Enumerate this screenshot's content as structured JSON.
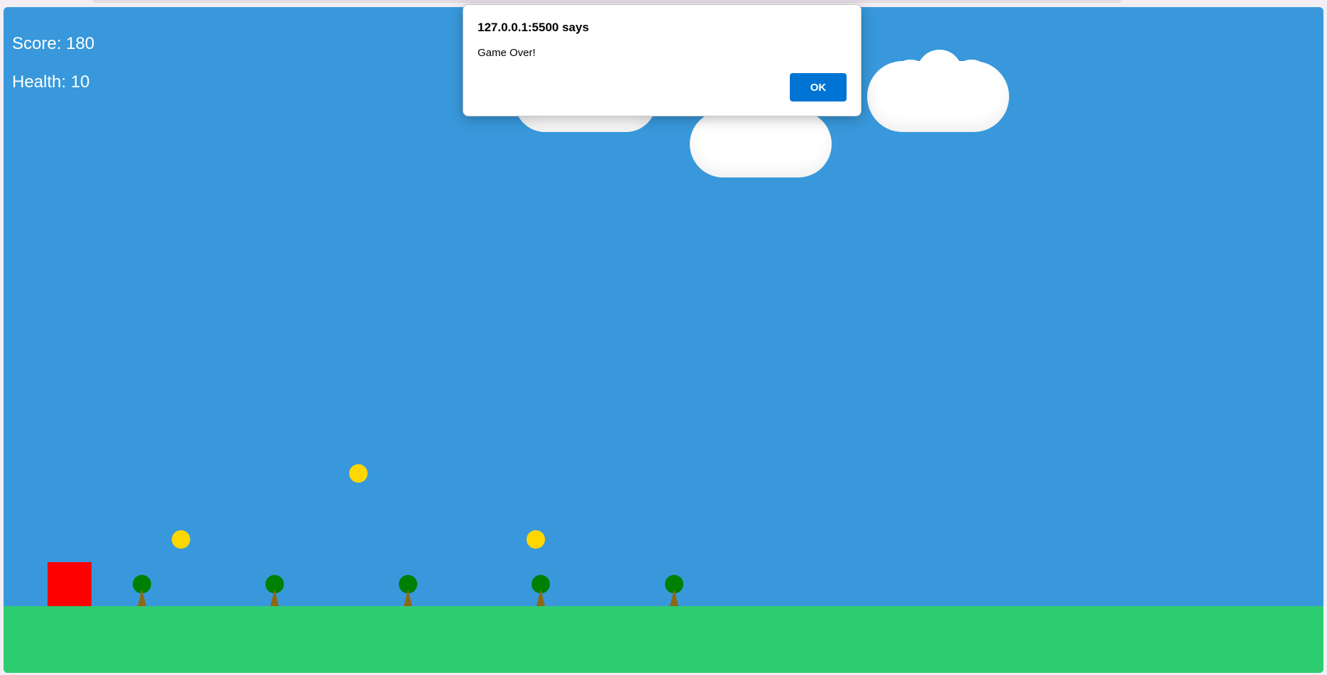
{
  "dialog": {
    "title": "127.0.0.1:5500 says",
    "message": "Game Over!",
    "ok_label": "OK"
  },
  "hud": {
    "score_text": "Score: 180",
    "health_text": "Health: 10"
  },
  "colors": {
    "sky": "#3898db",
    "ground": "#2ecc71",
    "player": "#ff0000",
    "coin": "#ffd700",
    "tree_leaves": "#008000",
    "tree_trunk": "#8b6914",
    "dialog_button": "#0074d4"
  }
}
